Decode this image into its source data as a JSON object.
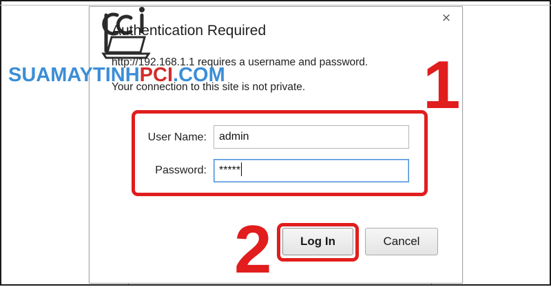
{
  "dialog": {
    "title": "Authentication Required",
    "message_line1": "http://192.168.1.1 requires a username and password.",
    "message_line2": "Your connection to this site is not private.",
    "close_glyph": "×"
  },
  "form": {
    "username_label": "User Name:",
    "username_value": "admin",
    "password_label": "Password:",
    "password_value": "*****"
  },
  "buttons": {
    "login_label": "Log In",
    "cancel_label": "Cancel"
  },
  "annotations": {
    "step1": "1",
    "step2": "2",
    "highlight_color": "#e11d1d"
  },
  "watermark": {
    "text_main": "SUAMAYTINH",
    "text_accent": "PCI",
    "text_suffix": ".COM",
    "main_color": "#3c8ed6",
    "accent_color": "#d42b2b",
    "logo_icon": "laptop-pci-logo"
  }
}
